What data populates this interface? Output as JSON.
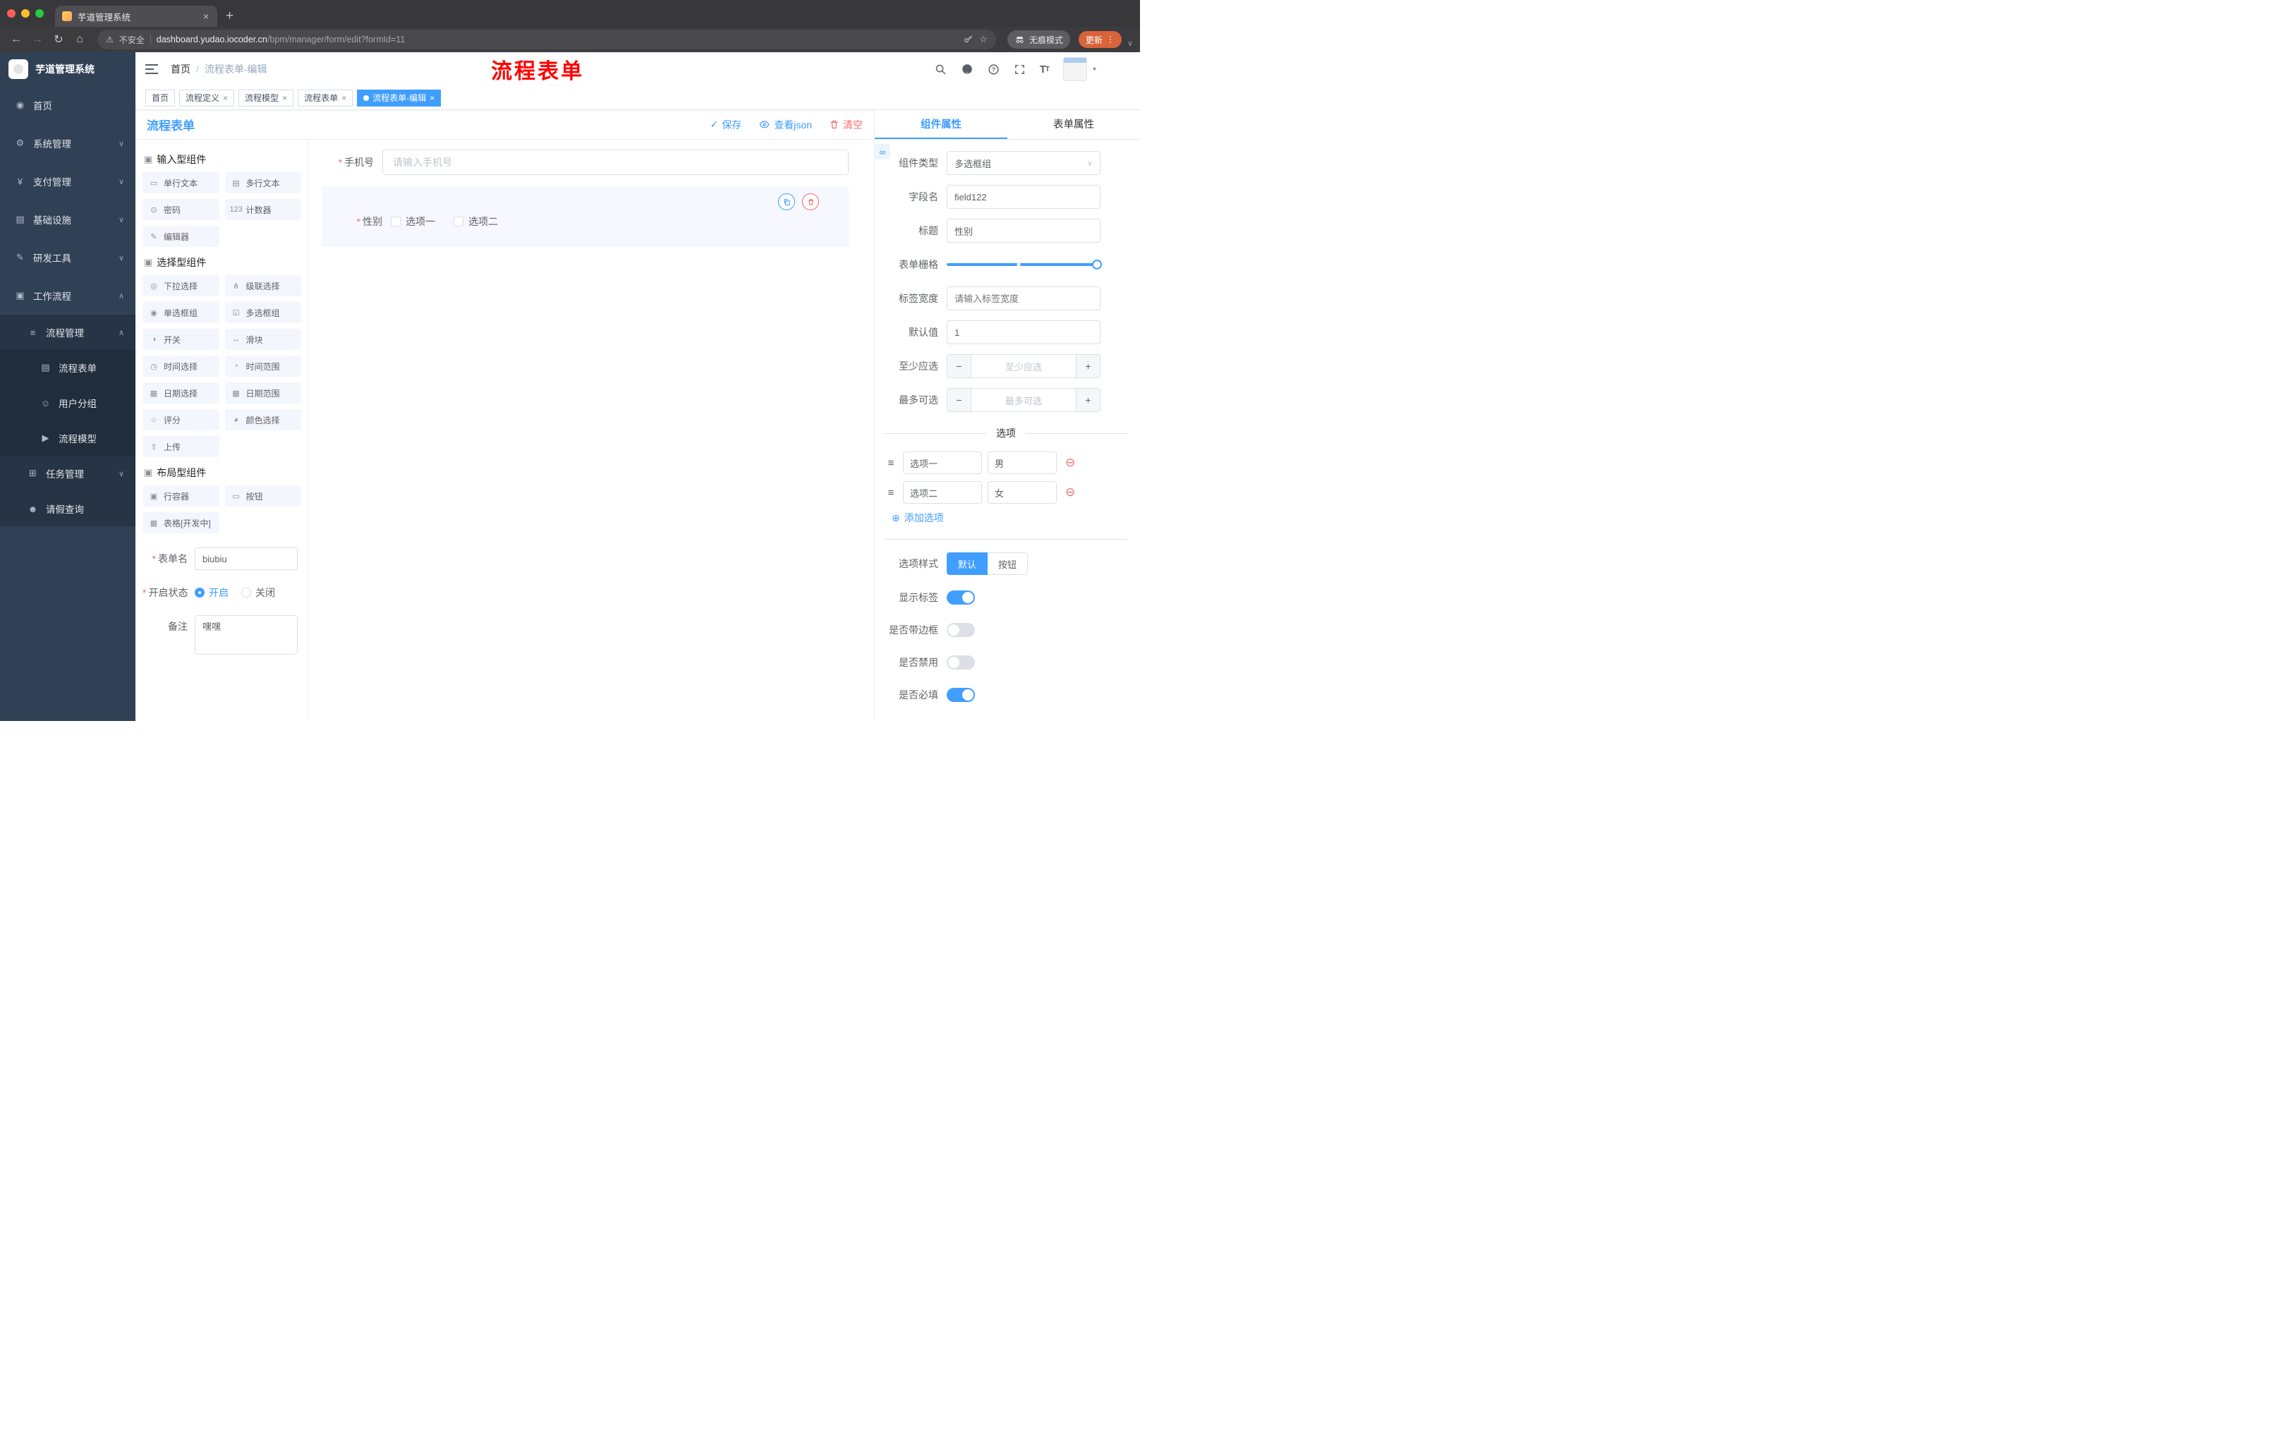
{
  "icons": {
    "close": "×",
    "plus": "+",
    "back": "←",
    "forward": "→",
    "reload": "↻",
    "home": "⌂",
    "warning": "⚠",
    "star": "☆",
    "kebab": "⋮",
    "chevron_down": "∨",
    "chevron_up": "∧",
    "caret_down": "▾",
    "check": "✓",
    "add_circle": "⊕",
    "remove_circle": "⊖",
    "drag": "≡",
    "minus": "−",
    "slash": "/",
    "asterisk": "*",
    "link": "∞"
  },
  "browser": {
    "tab_title": "芋道管理系统",
    "security_label": "不安全",
    "url_host": "dashboard.yudao.iocoder.cn",
    "url_path": "/bpm/manager/form/edit?formId=11",
    "incognito_label": "无痕模式",
    "update_label": "更新"
  },
  "sidebar": {
    "logo_title": "芋道管理系统",
    "items": [
      {
        "label": "首页",
        "glyph": "◉"
      },
      {
        "label": "系统管理",
        "glyph": "⚙"
      },
      {
        "label": "支付管理",
        "glyph": "¥"
      },
      {
        "label": "基础设施",
        "glyph": "▤"
      },
      {
        "label": "研发工具",
        "glyph": "✎"
      },
      {
        "label": "工作流程",
        "glyph": "▣"
      },
      {
        "label": "流程管理",
        "glyph": "≡"
      },
      {
        "label": "流程表单",
        "glyph": "▤"
      },
      {
        "label": "用户分组",
        "glyph": "☺"
      },
      {
        "label": "流程模型",
        "glyph": "▶"
      },
      {
        "label": "任务管理",
        "glyph": "⊞"
      },
      {
        "label": "请假查询",
        "glyph": "☻"
      }
    ]
  },
  "header": {
    "breadcrumb_home": "首页",
    "breadcrumb_current": "流程表单-编辑",
    "overlay_title": "流程表单"
  },
  "tags": [
    {
      "label": "首页"
    },
    {
      "label": "流程定义"
    },
    {
      "label": "流程模型"
    },
    {
      "label": "流程表单"
    },
    {
      "label": "流程表单-编辑"
    }
  ],
  "designer": {
    "title": "流程表单",
    "save_label": "保存",
    "view_json_label": "查看json",
    "clear_label": "清空",
    "groups": [
      {
        "title": "输入型组件",
        "items": [
          {
            "label": "单行文本",
            "glyph": "▭"
          },
          {
            "label": "多行文本",
            "glyph": "▤"
          },
          {
            "label": "密码",
            "glyph": "⊙"
          },
          {
            "label": "计数器",
            "glyph": "123"
          },
          {
            "label": "编辑器",
            "glyph": "✎"
          }
        ]
      },
      {
        "title": "选择型组件",
        "items": [
          {
            "label": "下拉选择",
            "glyph": "◎"
          },
          {
            "label": "级联选择",
            "glyph": "⋔"
          },
          {
            "label": "单选框组",
            "glyph": "◉"
          },
          {
            "label": "多选框组",
            "glyph": "☑"
          },
          {
            "label": "开关",
            "glyph": "◑"
          },
          {
            "label": "滑块",
            "glyph": "↔"
          },
          {
            "label": "时间选择",
            "glyph": "◷"
          },
          {
            "label": "时间范围",
            "glyph": "◔"
          },
          {
            "label": "日期选择",
            "glyph": "▦"
          },
          {
            "label": "日期范围",
            "glyph": "▦"
          },
          {
            "label": "评分",
            "glyph": "☆"
          },
          {
            "label": "颜色选择",
            "glyph": "◕"
          },
          {
            "label": "上传",
            "glyph": "⇧"
          }
        ]
      },
      {
        "title": "布局型组件",
        "items": [
          {
            "label": "行容器",
            "glyph": "▣"
          },
          {
            "label": "按钮",
            "glyph": "▭"
          },
          {
            "label": "表格[开发中]",
            "glyph": "▦"
          }
        ]
      }
    ],
    "meta": {
      "form_name_label": "表单名",
      "form_name_value": "biubiu",
      "status_label": "开启状态",
      "status_on": "开启",
      "status_off": "关闭",
      "remark_label": "备注",
      "remark_value": "嘿嘿"
    },
    "canvas": {
      "phone_label": "手机号",
      "phone_placeholder": "请输入手机号",
      "gender_label": "性别",
      "gender_option_1": "选项一",
      "gender_option_2": "选项二"
    }
  },
  "props": {
    "tab_component": "组件属性",
    "tab_form": "表单属性",
    "rows": {
      "type_label": "组件类型",
      "type_value": "多选框组",
      "field_label": "字段名",
      "field_value": "field122",
      "title_label": "标题",
      "title_value": "性别",
      "grid_label": "表单栅格",
      "width_label": "标签宽度",
      "width_placeholder": "请输入标签宽度",
      "default_label": "默认值",
      "default_value": "1",
      "min_label": "至少应选",
      "min_placeholder": "至少应选",
      "max_label": "最多可选",
      "max_placeholder": "最多可选"
    },
    "options": {
      "divider_title": "选项",
      "row1_label": "选项一",
      "row1_value": "男",
      "row2_label": "选项二",
      "row2_value": "女",
      "add_label": "添加选项"
    },
    "style": {
      "option_style_label": "选项样式",
      "seg_default": "默认",
      "seg_button": "按钮",
      "toggle_show_label": "显示标签",
      "toggle_border_label": "是否带边框",
      "toggle_disabled_label": "是否禁用",
      "toggle_required_label": "是否必填"
    }
  }
}
